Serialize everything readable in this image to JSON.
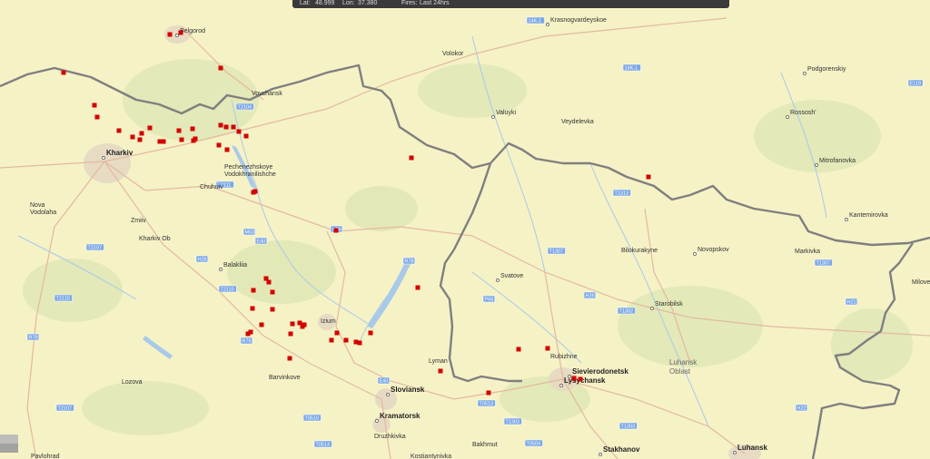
{
  "status_bar": {
    "lat_label": "Lat:",
    "lat_value": "48.999",
    "lon_label": "Lon:",
    "lon_value": "37.380",
    "fires_label": "Fires:",
    "fires_value": "Last 24hrs"
  },
  "map": {
    "colors": {
      "background": "#f5f2c6",
      "border": "#7f7f7f",
      "fire": "#d40000",
      "water": "#a9c9e9",
      "road": "#e3b9a0",
      "shield": "#7aa7e6"
    },
    "places": [
      {
        "id": "belgorod",
        "text": "Belgorod"
      },
      {
        "id": "krasnogvardeyskoe",
        "text": "Krasnogvardeyskoe"
      },
      {
        "id": "volokor",
        "text": "Volokor"
      },
      {
        "id": "podgorenskiy",
        "text": "Podgorenskiy"
      },
      {
        "id": "vovchansk",
        "text": "Vovchansk"
      },
      {
        "id": "valuyki",
        "text": "Valuyki"
      },
      {
        "id": "veydelevka",
        "text": "Veydelevka"
      },
      {
        "id": "rossosh",
        "text": "Rossosh'"
      },
      {
        "id": "kharkiv",
        "text": "Kharkiv"
      },
      {
        "id": "pechenezhskoye",
        "text": "Pechenezhskoye"
      },
      {
        "id": "vodokhranilishche",
        "text": "Vodokhranilishche"
      },
      {
        "id": "mitrofanovka",
        "text": "Mitrofanovka"
      },
      {
        "id": "chuhuiv",
        "text": "Chuhuiv"
      },
      {
        "id": "nova-vodolaha-1",
        "text": "Nova"
      },
      {
        "id": "nova-vodolaha-2",
        "text": "Vodolaha"
      },
      {
        "id": "kantemirovka",
        "text": "Kantemirovka"
      },
      {
        "id": "zmiiv",
        "text": "Zmiiv"
      },
      {
        "id": "kharkiv-ob",
        "text": "Kharkiv Ob"
      },
      {
        "id": "bilokurakyne",
        "text": "Bilokurakyne"
      },
      {
        "id": "novopskov",
        "text": "Novopskov"
      },
      {
        "id": "markivka",
        "text": "Markivka"
      },
      {
        "id": "balakliia",
        "text": "Balakliia"
      },
      {
        "id": "svatove",
        "text": "Svatove"
      },
      {
        "id": "milove",
        "text": "Milove"
      },
      {
        "id": "starobilsk",
        "text": "Starobilsk"
      },
      {
        "id": "izium",
        "text": "Izium"
      },
      {
        "id": "rubizhne",
        "text": "Rubizhne"
      },
      {
        "id": "lyman",
        "text": "Lyman"
      },
      {
        "id": "luhansk-oblast-1",
        "text": "Luhansk"
      },
      {
        "id": "luhansk-oblast-2",
        "text": "Oblast"
      },
      {
        "id": "sievierodonetsk",
        "text": "Sievierodonetsk"
      },
      {
        "id": "lysychansk",
        "text": "Lysychansk"
      },
      {
        "id": "barvinkove",
        "text": "Barvinkove"
      },
      {
        "id": "lozova",
        "text": "Lozova"
      },
      {
        "id": "sloviansk",
        "text": "Sloviansk"
      },
      {
        "id": "kramatorsk",
        "text": "Kramatorsk"
      },
      {
        "id": "druzhkivka",
        "text": "Druzhkivka"
      },
      {
        "id": "bakhmut",
        "text": "Bakhmut"
      },
      {
        "id": "stakhanov",
        "text": "Stakhanov"
      },
      {
        "id": "luhansk",
        "text": "Luhansk"
      },
      {
        "id": "pavlohrad",
        "text": "Pavlohrad"
      },
      {
        "id": "kostiantynivka",
        "text": "Kostiantynivka"
      }
    ],
    "road_shields": [
      {
        "id": "s1",
        "text": "14K-1"
      },
      {
        "id": "s2",
        "text": "14K-1"
      },
      {
        "id": "s3",
        "text": "E119"
      },
      {
        "id": "s4",
        "text": "T2104"
      },
      {
        "id": "s5",
        "text": "T1313"
      },
      {
        "id": "s6",
        "text": "T2111"
      },
      {
        "id": "s7",
        "text": "M03"
      },
      {
        "id": "s8",
        "text": "H26"
      },
      {
        "id": "s9",
        "text": "E40"
      },
      {
        "id": "s10",
        "text": "T2107"
      },
      {
        "id": "s11",
        "text": "T1307"
      },
      {
        "id": "s12",
        "text": "T1307"
      },
      {
        "id": "s13",
        "text": "R78"
      },
      {
        "id": "s14",
        "text": "H26"
      },
      {
        "id": "s15",
        "text": "T2110"
      },
      {
        "id": "s16",
        "text": "T2110"
      },
      {
        "id": "s17",
        "text": "P66"
      },
      {
        "id": "s18",
        "text": "H26"
      },
      {
        "id": "s19",
        "text": "T1302"
      },
      {
        "id": "s20",
        "text": "H21"
      },
      {
        "id": "s21",
        "text": "R78"
      },
      {
        "id": "s22",
        "text": "R78"
      },
      {
        "id": "s23",
        "text": "E40"
      },
      {
        "id": "s24",
        "text": "T0513"
      },
      {
        "id": "s25",
        "text": "T1303"
      },
      {
        "id": "s26",
        "text": "T2107"
      },
      {
        "id": "s27",
        "text": "T0510"
      },
      {
        "id": "s28",
        "text": "T1303"
      },
      {
        "id": "s29",
        "text": "H22"
      },
      {
        "id": "s30",
        "text": "T0514"
      },
      {
        "id": "s31",
        "text": "T0504"
      }
    ]
  }
}
